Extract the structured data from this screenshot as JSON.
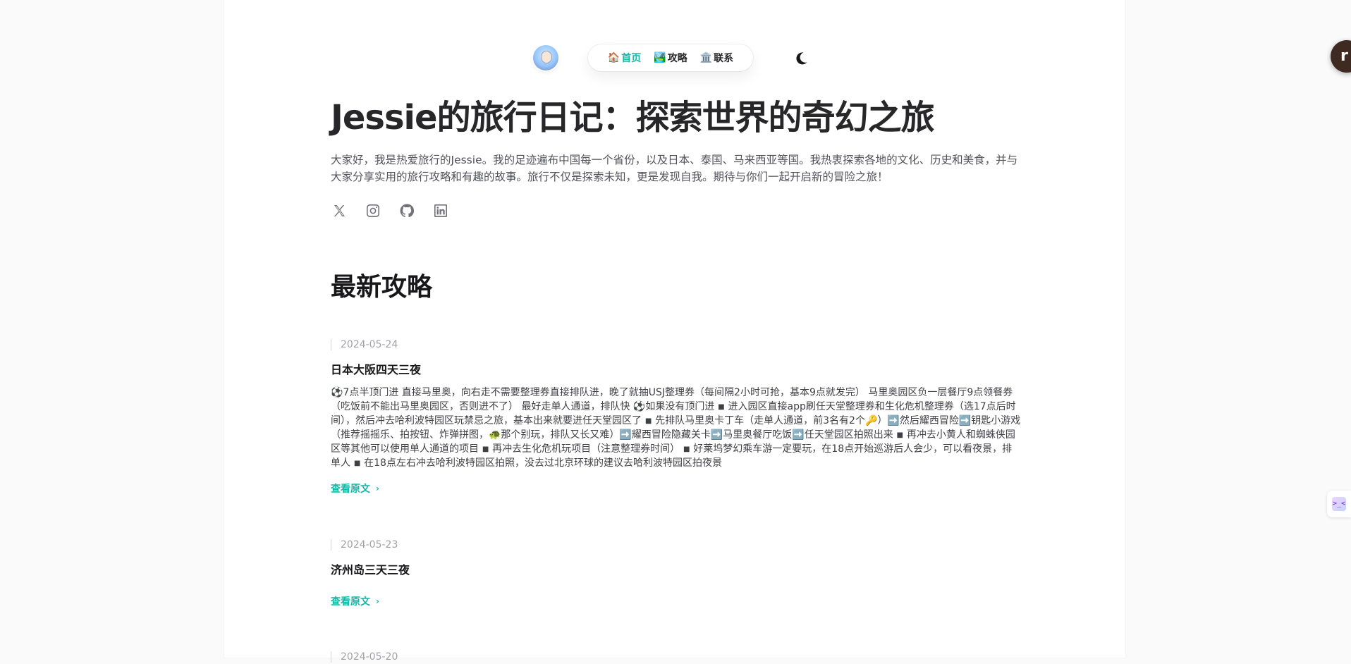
{
  "header": {
    "nav": [
      {
        "emoji": "🏠",
        "label": "首页",
        "active": true
      },
      {
        "emoji": "🏞️",
        "label": "攻略",
        "active": false
      },
      {
        "emoji": "🏛️",
        "label": "联系",
        "active": false
      }
    ],
    "theme_toggle_icon": "moon-icon"
  },
  "intro": {
    "title": "Jessie的旅行日记：探索世界的奇幻之旅",
    "description": "大家好，我是热爱旅行的Jessie。我的足迹遍布中国每一个省份，以及日本、泰国、马来西亚等国。我热衷探索各地的文化、历史和美食，并与大家分享实用的旅行攻略和有趣的故事。旅行不仅是探索未知，更是发现自我。期待与你们一起开启新的冒险之旅！",
    "socials": [
      "x-icon",
      "instagram-icon",
      "github-icon",
      "linkedin-icon"
    ]
  },
  "latest": {
    "heading": "最新攻略",
    "posts": [
      {
        "date": "2024-05-24",
        "title": "日本大阪四天三夜",
        "body": "⚽7点半顶门进 直接马里奥，向右走不需要整理券直接排队进，晚了就抽USJ整理券（每间隔2小时可抢，基本9点就发完） 马里奥园区负一层餐厅9点领餐券（吃饭前不能出马里奥园区，否则进不了） 最好走单人通道，排队快 ⚽如果没有顶门进 ◾ 进入园区直接app刷任天堂整理券和生化危机整理券（选17点后时间），然后冲去哈利波特园区玩禁忌之旅，基本出来就要进任天堂园区了 ◾ 先排队马里奥卡丁车（走单人通道，前3名有2个🔑）➡️然后耀西冒险➡️钥匙小游戏（推荐摇摇乐、拍按钮、炸弹拼图，🐢那个别玩，排队又长又难）➡️耀西冒险隐藏关卡➡️马里奥餐厅吃饭➡️任天堂园区拍照出来 ◾ 再冲去小黄人和蜘蛛侠园区等其他可以使用单人通道的项目 ◾ 再冲去生化危机玩项目（注意整理券时间） ◾ 好莱坞梦幻乘车游一定要玩，在18点开始巡游后人会少，可以看夜景，排单人 ◾ 在18点左右冲去哈利波特园区拍照，没去过北京环球的建议去哈利波特园区拍夜景",
        "read_more": "查看原文"
      },
      {
        "date": "2024-05-23",
        "title": "济州岛三天三夜",
        "body": "",
        "read_more": "查看原文"
      },
      {
        "date": "2024-05-20"
      }
    ]
  },
  "widgets": {
    "float_button_letter": "r",
    "side_tab_glyph": ">_<"
  },
  "colors": {
    "accent": "#14b8a6",
    "background": "#fafafa",
    "card": "#ffffff"
  }
}
